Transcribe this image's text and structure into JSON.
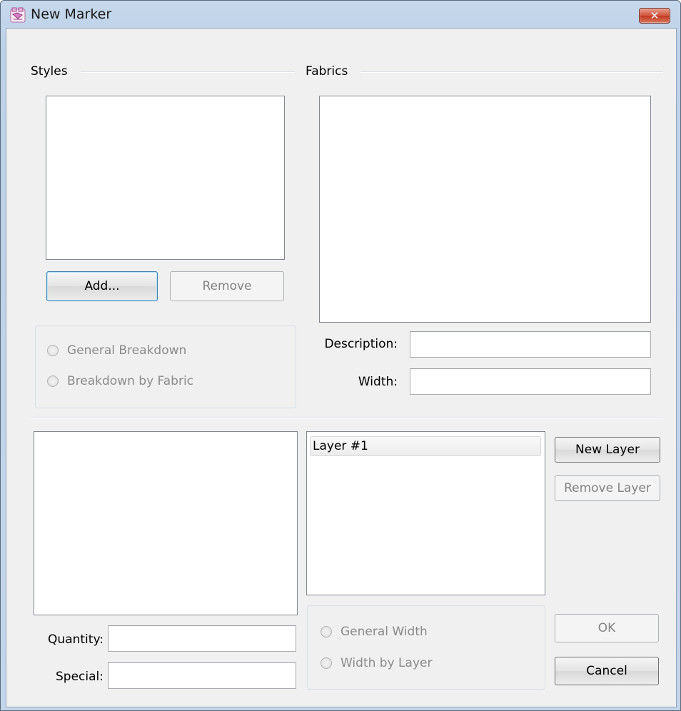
{
  "window": {
    "title": "New Marker",
    "close_glyph": "✕",
    "icon": "marker-app-icon"
  },
  "styles": {
    "label": "Styles",
    "items": [],
    "add_button": "Add...",
    "remove_button": "Remove"
  },
  "fabrics": {
    "label": "Fabrics",
    "items": []
  },
  "breakdown": {
    "general": "General Breakdown",
    "by_fabric": "Breakdown by Fabric"
  },
  "fabric_fields": {
    "description_label": "Description:",
    "description_value": "",
    "width_label": "Width:",
    "width_value": ""
  },
  "layers": {
    "items": [
      "Layer #1"
    ],
    "new_button": "New Layer",
    "remove_button": "Remove Layer"
  },
  "width_mode": {
    "general": "General Width",
    "by_layer": "Width by Layer"
  },
  "quantity": {
    "label": "Quantity:",
    "value": ""
  },
  "special": {
    "label": "Special:",
    "value": ""
  },
  "actions": {
    "ok": "OK",
    "cancel": "Cancel"
  }
}
